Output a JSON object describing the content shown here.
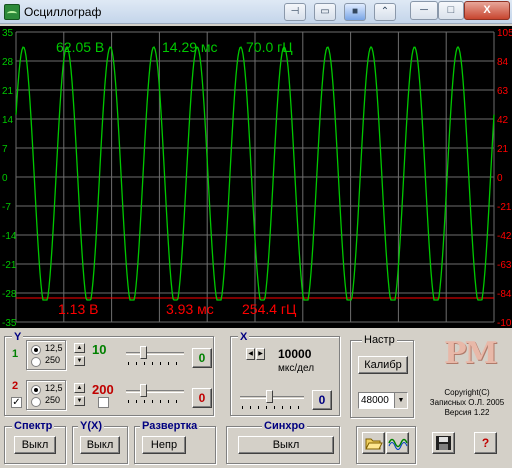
{
  "window": {
    "title": "Осциллограф",
    "toolbar_icons": [
      "pin-icon",
      "restore-pane-icon",
      "color-icon",
      "collapse-icon"
    ],
    "controls": {
      "minimize": "─",
      "maximize": "□",
      "close": "X"
    }
  },
  "scope": {
    "left_axis_ticks": [
      "35",
      "28",
      "21",
      "14",
      "7",
      "0",
      "-7",
      "-14",
      "-21",
      "-28",
      "-35"
    ],
    "right_axis_ticks": [
      "105",
      "84",
      "63",
      "42",
      "21",
      "0",
      "-21",
      "-42",
      "-63",
      "-84",
      "-105"
    ],
    "top_readout": {
      "voltage": "62.05 В",
      "time": "14.29 мс",
      "frequency": "70.0 гЦ"
    },
    "bottom_readout": {
      "voltage": "1.13 В",
      "time": "3.93 мс",
      "frequency": "254.4 гЦ"
    },
    "trace_color": "#00c800",
    "grid_color": "#6e6e6e",
    "cursor_color": "#ff0000",
    "left_axis_color": "#00c800",
    "right_axis_color": "#ff0000"
  },
  "channel_y": {
    "title": "Y",
    "ch1": {
      "label": "1",
      "radio_a": "12,5",
      "radio_b": "250",
      "gain": "10",
      "offset_value": "0"
    },
    "ch2": {
      "label": "2",
      "radio_a": "12,5",
      "radio_b": "250",
      "gain": "200",
      "offset_value": "0"
    }
  },
  "channel_x": {
    "title": "X",
    "timebase_value": "10000",
    "timebase_unit": "мкс/дел",
    "offset_value": "0"
  },
  "settings": {
    "title": "Настр",
    "calibrate_label": "Калибр",
    "sample_rate": "48000"
  },
  "about": {
    "logo": "PM",
    "copyright_line1": "Copyright(C)",
    "copyright_line2": "Записных О.Л. 2005",
    "copyright_line3": "Версия 1.22"
  },
  "bottom": {
    "spectrum": {
      "title": "Спектр",
      "button": "Выкл"
    },
    "yx": {
      "title": "Y(X)",
      "button": "Выкл"
    },
    "sweep": {
      "title": "Развертка",
      "button": "Непр"
    },
    "sync": {
      "title": "Синхро",
      "button": "Выкл"
    }
  }
}
